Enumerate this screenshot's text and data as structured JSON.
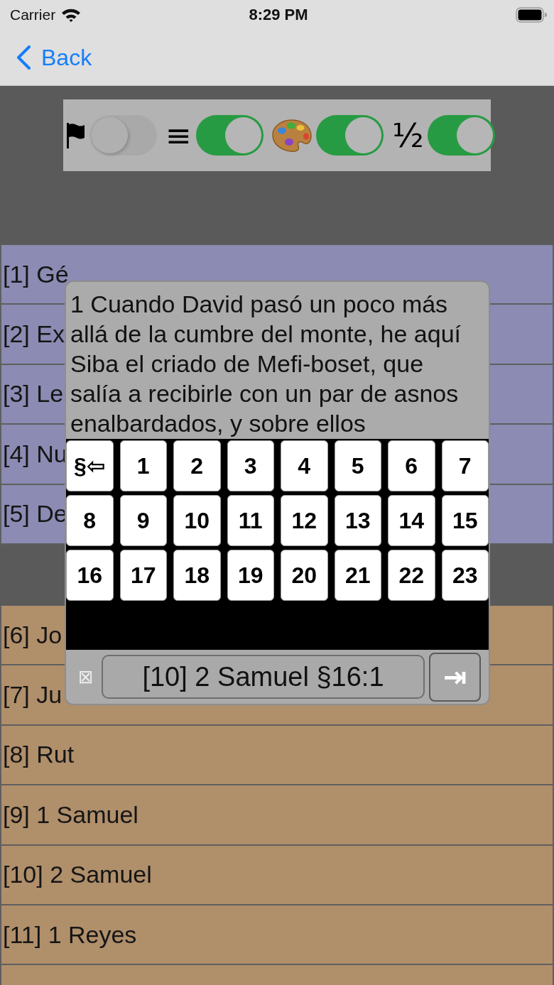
{
  "status_bar": {
    "carrier": "Carrier",
    "time": "8:29 PM"
  },
  "nav": {
    "back": "Back"
  },
  "toggles": [
    {
      "kind": "flag",
      "on": false
    },
    {
      "kind": "symbol",
      "label": "≡",
      "on": true
    },
    {
      "kind": "palette",
      "on": true
    },
    {
      "kind": "symbol",
      "label": "½",
      "on": true
    }
  ],
  "sections": [
    {
      "color": "#8b8bb3",
      "rows": [
        "[1] Gé",
        "[2] Ex",
        "[3] Le",
        "[4] Nu",
        "[5] De"
      ]
    },
    {
      "color": "#b08f6b",
      "rows": [
        "[6] Jo",
        "[7] Ju",
        "[8] Rut",
        "[9] 1 Samuel",
        "[10] 2 Samuel",
        "[11] 1 Reyes"
      ]
    }
  ],
  "popup": {
    "verse": "1 Cuando David pasó un poco más allá de la cumbre del monte, he aquí Siba el criado de Mefi-boset, que salía a recibirle con un par de asnos enalbardados, y sobre ellos",
    "keys": [
      "§⇦",
      "1",
      "2",
      "3",
      "4",
      "5",
      "6",
      "7",
      "8",
      "9",
      "10",
      "11",
      "12",
      "13",
      "14",
      "15",
      "16",
      "17",
      "18",
      "19",
      "20",
      "21",
      "22",
      "23"
    ],
    "clear": "⊠",
    "reference": "[10] 2 Samuel §16:1",
    "go": "⇥"
  }
}
